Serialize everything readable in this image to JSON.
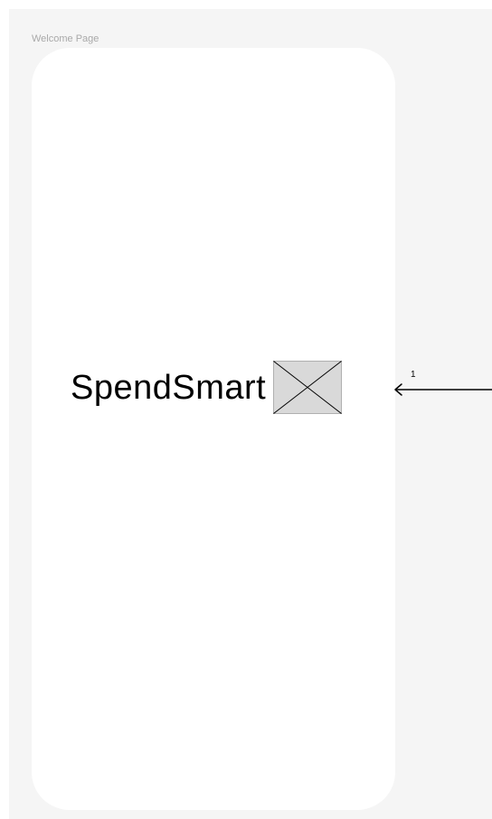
{
  "frame": {
    "label": "Welcome Page"
  },
  "welcome": {
    "app_name": "SpendSmart",
    "logo_icon": "image-placeholder-icon"
  },
  "prototype_link": {
    "number": "1",
    "icon": "arrow-left-icon"
  },
  "colors": {
    "canvas": "#f5f5f5",
    "frame": "#ffffff",
    "placeholder_fill": "#d9d9d9",
    "placeholder_stroke": "#000000",
    "label": "#a9a9a9"
  }
}
